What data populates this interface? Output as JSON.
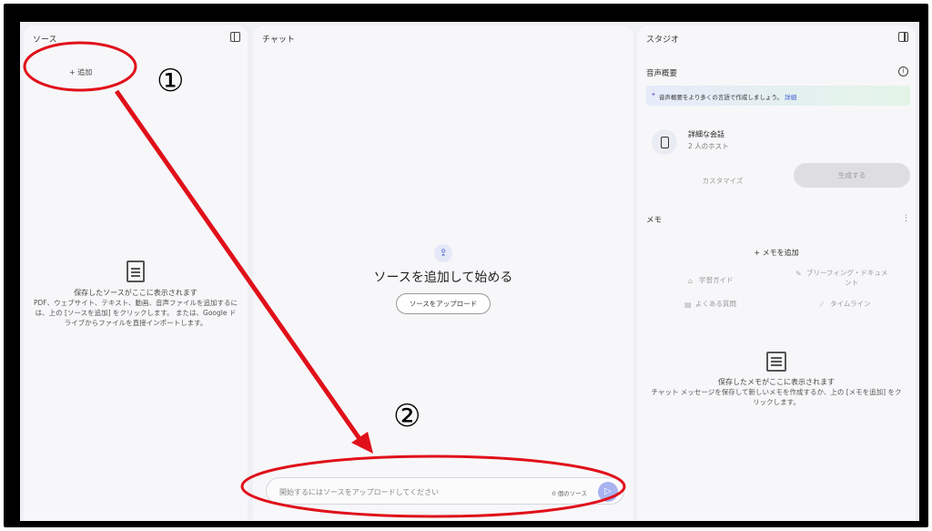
{
  "sources": {
    "title": "ソース",
    "add_label": "+ 追加",
    "empty_title": "保存したソースがここに表示されます",
    "empty_body": "PDF、ウェブサイト、テキスト、動画、音声ファイルを追加するには、上の [ソースを追加] をクリックします。 または、Google ドライブからファイルを直接インポートします。"
  },
  "chat": {
    "title": "チャット",
    "upload_icon": "⇪",
    "heading": "ソースを追加して始める",
    "upload_button": "ソースをアップロード",
    "input_placeholder": "開始するにはソースをアップロードしてください",
    "source_count": "0 個のソース",
    "send_icon": "▷"
  },
  "studio": {
    "title": "スタジオ",
    "audio_overview": "音声概要",
    "banner_text": "音声概要をより多くの言語で作成しましょう。",
    "banner_link": "詳細",
    "conversation_title": "詳細な会話",
    "conversation_sub": "2 人のホスト",
    "customize": "カスタマイズ",
    "generate": "生成する",
    "memo_label": "メモ",
    "memo_menu": "⋮",
    "add_memo": "+ メモを追加",
    "quick_actions": {
      "study_guide": "学習ガイド",
      "briefing_line1": "ブリーフィング・ドキュメ",
      "briefing_line2": "ント",
      "faq": "よくある質問",
      "timeline": "タイムライン"
    },
    "memo_empty_title": "保存したメモがここに表示されます",
    "memo_empty_body": "チャット メッセージを保存して新しいメモを作成するか、上の [メモを追加] をクリックします。"
  },
  "annotations": {
    "marker1": "①",
    "marker2": "②",
    "annotation_color": "#e0101a"
  }
}
